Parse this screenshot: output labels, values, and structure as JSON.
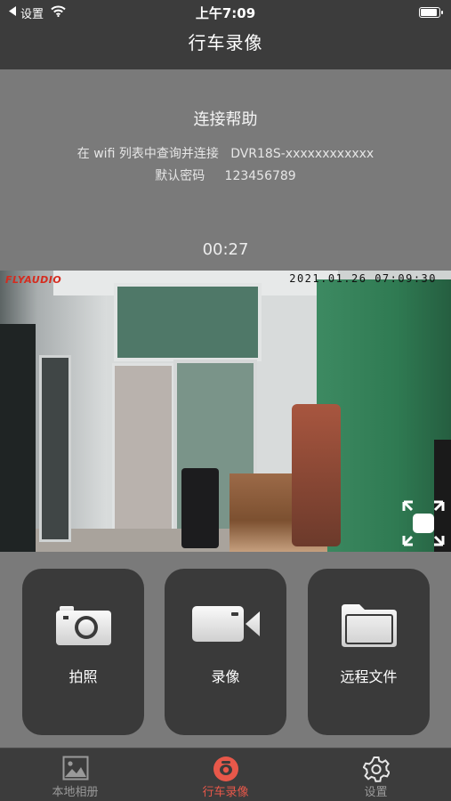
{
  "status_bar": {
    "back_label": "设置",
    "time": "上午7:09",
    "icons": [
      "back-arrow-icon",
      "wifi-icon",
      "battery-icon"
    ]
  },
  "nav": {
    "title": "行车录像"
  },
  "help": {
    "title": "连接帮助",
    "line1": "在 wifi 列表中查询并连接   DVR18S-xxxxxxxxxxxx",
    "line2": "默认密码     123456789",
    "timer": "00:27"
  },
  "video": {
    "brand_text": "FLYAUDIO",
    "timestamp": "2021.01.26 07:09:30",
    "fullscreen_icon": "fullscreen-icon"
  },
  "actions": [
    {
      "label": "拍照",
      "icon": "camera-icon"
    },
    {
      "label": "录像",
      "icon": "video-camera-icon"
    },
    {
      "label": "远程文件",
      "icon": "folder-icon"
    }
  ],
  "tabs": [
    {
      "label": "本地相册",
      "icon": "image-icon",
      "active": false
    },
    {
      "label": "行车录像",
      "icon": "dashcam-icon",
      "active": true
    },
    {
      "label": "设置",
      "icon": "gear-icon",
      "active": false
    }
  ],
  "colors": {
    "accent": "#e8584a",
    "card_bg": "#3a3a3a",
    "panel_bg": "#7a7a7a",
    "bar_bg": "#3c3c3c"
  }
}
